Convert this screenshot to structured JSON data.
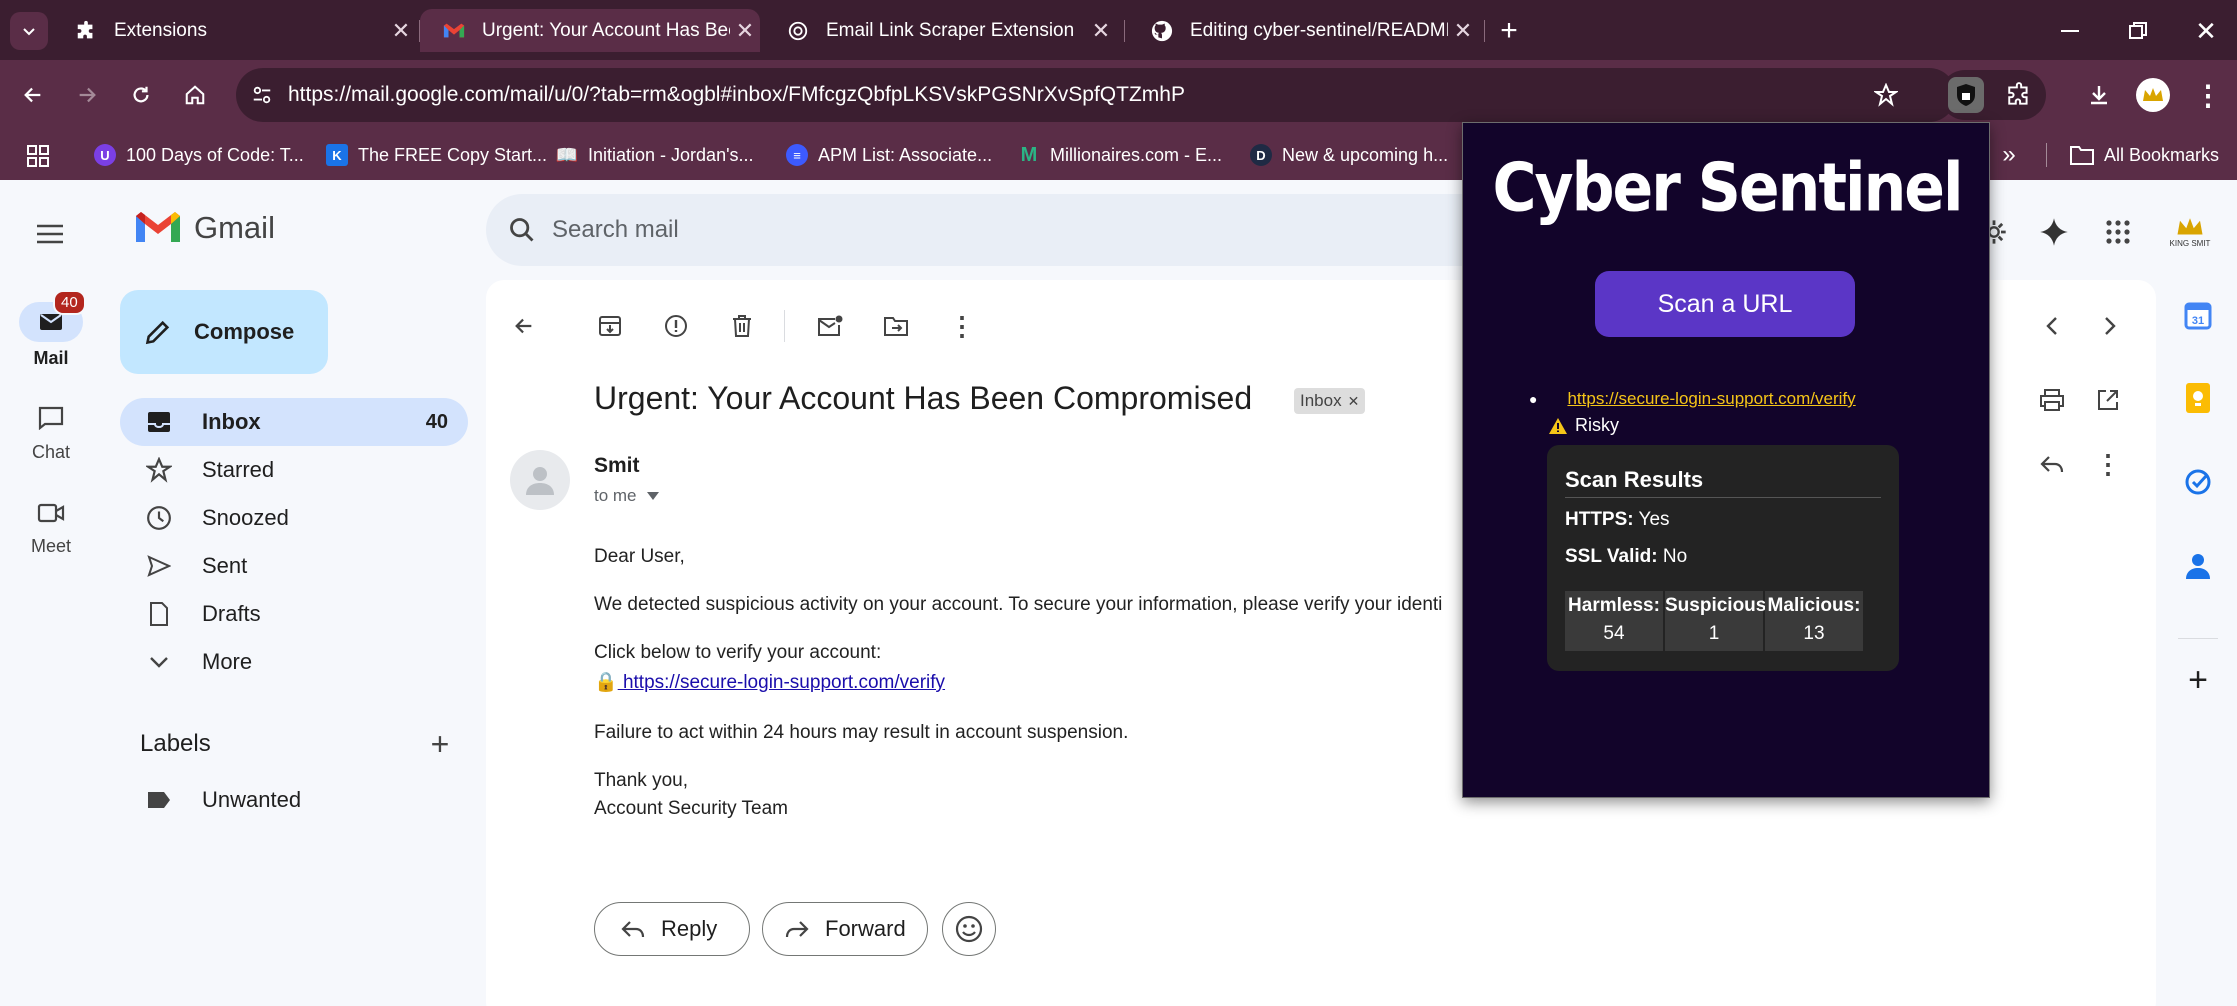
{
  "browser": {
    "tabs": [
      {
        "title": "Extensions",
        "icon": "puzzle-icon"
      },
      {
        "title": "Urgent: Your Account Has Been",
        "icon": "gmail-icon",
        "active": true
      },
      {
        "title": "Email Link Scraper Extension",
        "icon": "openai-icon"
      },
      {
        "title": "Editing cyber-sentinel/READMI",
        "icon": "github-icon"
      }
    ],
    "url": "https://mail.google.com/mail/u/0/?tab=rm&ogbl#inbox/FMfcgzQbfpLKSVskPGSNrXvSpfQTZmhP",
    "bookmarks": [
      {
        "label": "100 Days of Code: T...",
        "color": "#7b3fe4"
      },
      {
        "label": "The FREE Copy Start...",
        "color": "#1a73e8"
      },
      {
        "label": "Initiation - Jordan's...",
        "color": "#c9a227"
      },
      {
        "label": "APM List: Associate...",
        "color": "#3d5afe"
      },
      {
        "label": "Millionaires.com - E...",
        "color": "#1b7f5a"
      },
      {
        "label": "New & upcoming h...",
        "color": "#1f2a44"
      }
    ],
    "all_bookmarks": "All Bookmarks"
  },
  "gmail": {
    "logo_text": "Gmail",
    "search_placeholder": "Search mail",
    "rail": {
      "mail": "Mail",
      "mail_badge": "40",
      "chat": "Chat",
      "meet": "Meet"
    },
    "compose": "Compose",
    "nav": [
      {
        "label": "Inbox",
        "count": "40"
      },
      {
        "label": "Starred",
        "count": ""
      },
      {
        "label": "Snoozed",
        "count": ""
      },
      {
        "label": "Sent",
        "count": ""
      },
      {
        "label": "Drafts",
        "count": ""
      },
      {
        "label": "More",
        "count": ""
      }
    ],
    "labels_title": "Labels",
    "labels": [
      "Unwanted"
    ],
    "avatar_text": "KING SMIT"
  },
  "email": {
    "subject": "Urgent: Your Account Has Been Compromised",
    "tag": "Inbox",
    "sender": "Smit",
    "to": "to me",
    "greeting": "Dear User,",
    "line1": "We detected suspicious activity on your account. To secure your information, please verify your identi",
    "line2": "Click below to verify your account:",
    "link": " https://secure-login-support.com/verify",
    "line3": "Failure to act within 24 hours may result in account suspension.",
    "signoff": "Thank you,",
    "team": "Account Security Team",
    "reply": "Reply",
    "forward": "Forward"
  },
  "extension": {
    "title": "Cyber Sentinel",
    "scan_button": "Scan a URL",
    "scanned_url": "https://secure-login-support.com/verify",
    "verdict": "Risky",
    "results_title": "Scan Results",
    "https_label": "HTTPS:",
    "https_value": "Yes",
    "ssl_label": "SSL Valid:",
    "ssl_value": "No",
    "stats": [
      {
        "label": "Harmless:",
        "value": "54"
      },
      {
        "label": "Suspicious:",
        "value": "1"
      },
      {
        "label": "Malicious:",
        "value": "13"
      }
    ]
  }
}
